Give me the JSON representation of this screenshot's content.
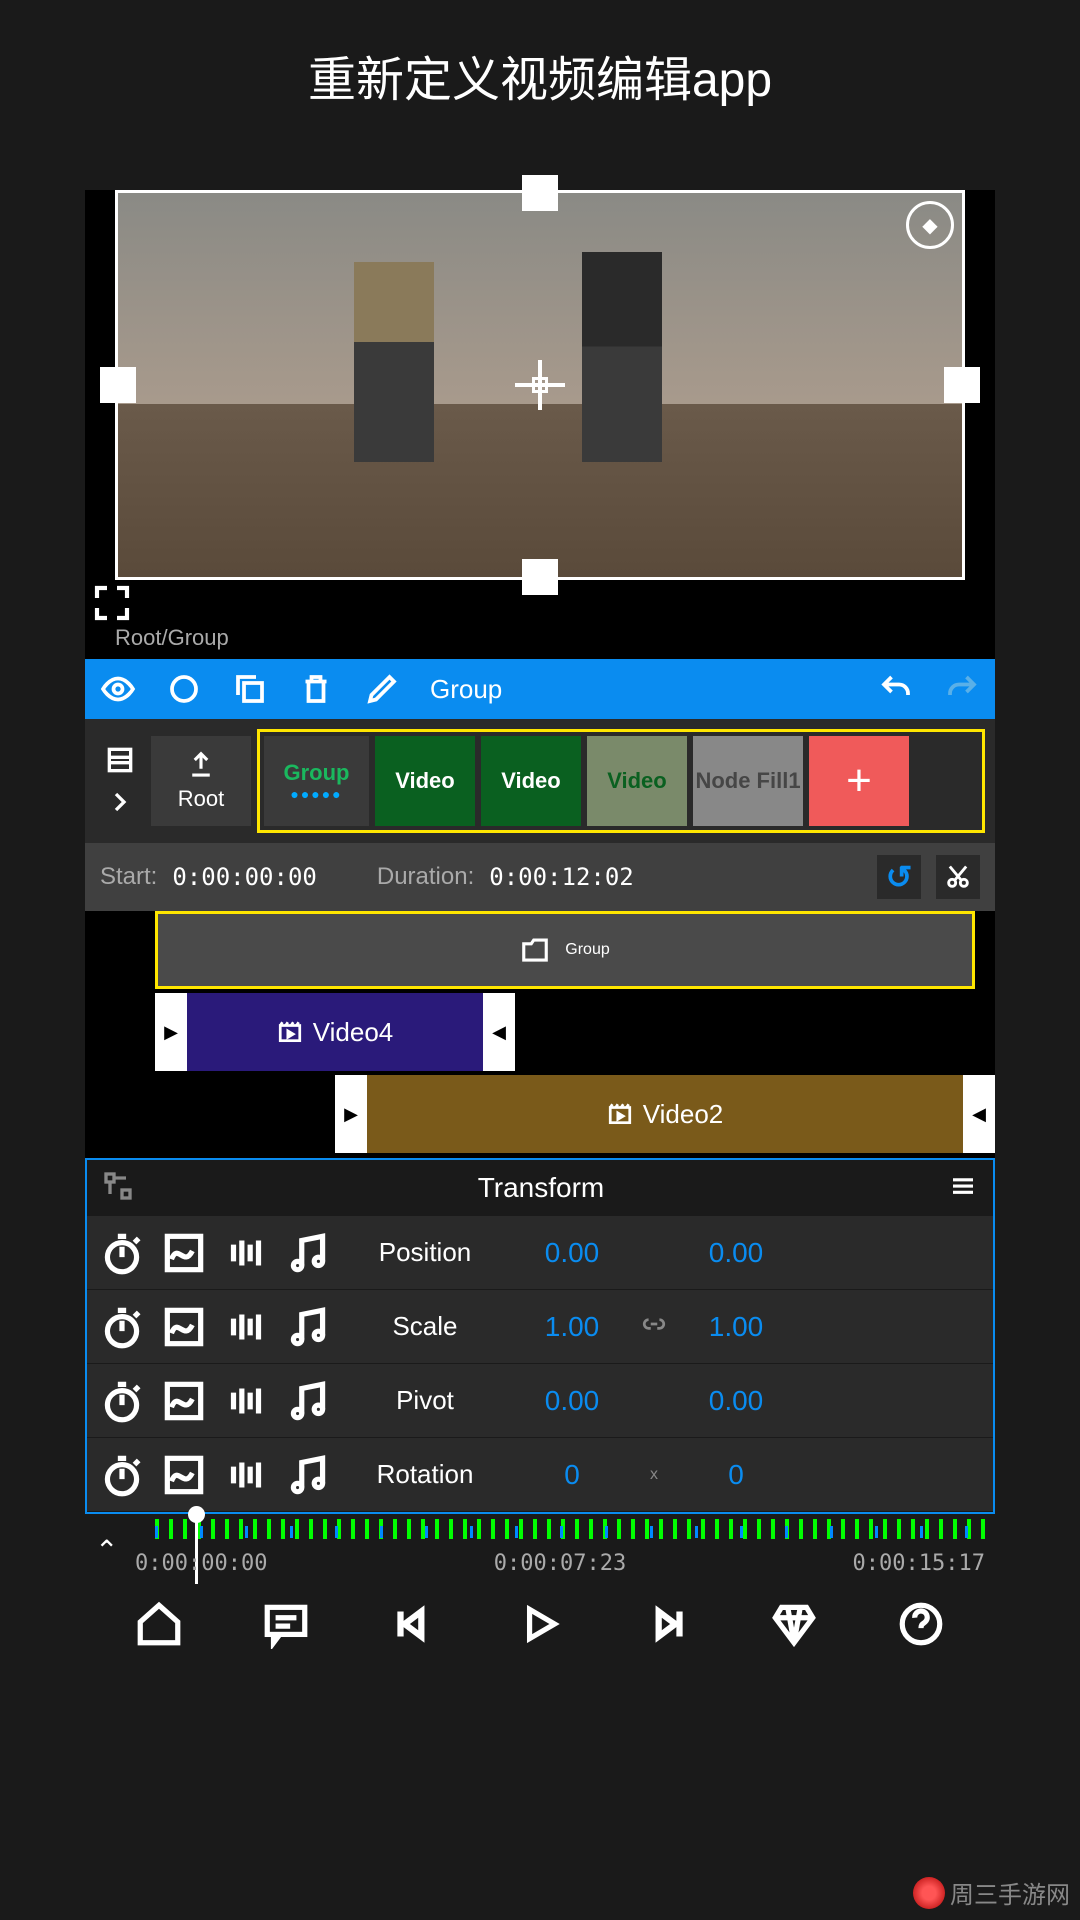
{
  "page_title": "重新定义视频编辑app",
  "breadcrumb": "Root/Group",
  "toolbar_label": "Group",
  "root_label": "Root",
  "layers": {
    "group": "Group",
    "video1": "Video",
    "video2": "Video",
    "video3": "Video",
    "nodefill": "Node Fill1"
  },
  "time": {
    "start_label": "Start:",
    "start_value": "0:00:00:00",
    "duration_label": "Duration:",
    "duration_value": "0:00:12:02"
  },
  "clips": {
    "group": "Group",
    "video4": "Video4",
    "video2": "Video2"
  },
  "transform": {
    "title": "Transform",
    "rows": [
      {
        "label": "Position",
        "v1": "0.00",
        "sep": "",
        "v2": "0.00"
      },
      {
        "label": "Scale",
        "v1": "1.00",
        "sep": "link",
        "v2": "1.00"
      },
      {
        "label": "Pivot",
        "v1": "0.00",
        "sep": "",
        "v2": "0.00"
      },
      {
        "label": "Rotation",
        "v1": "0",
        "sep": "x",
        "v2": "0"
      }
    ]
  },
  "ruler": {
    "t0": "0:00:00:00",
    "t1": "0:00:07:23",
    "t2": "0:00:15:17"
  },
  "watermark": "周三手游网"
}
